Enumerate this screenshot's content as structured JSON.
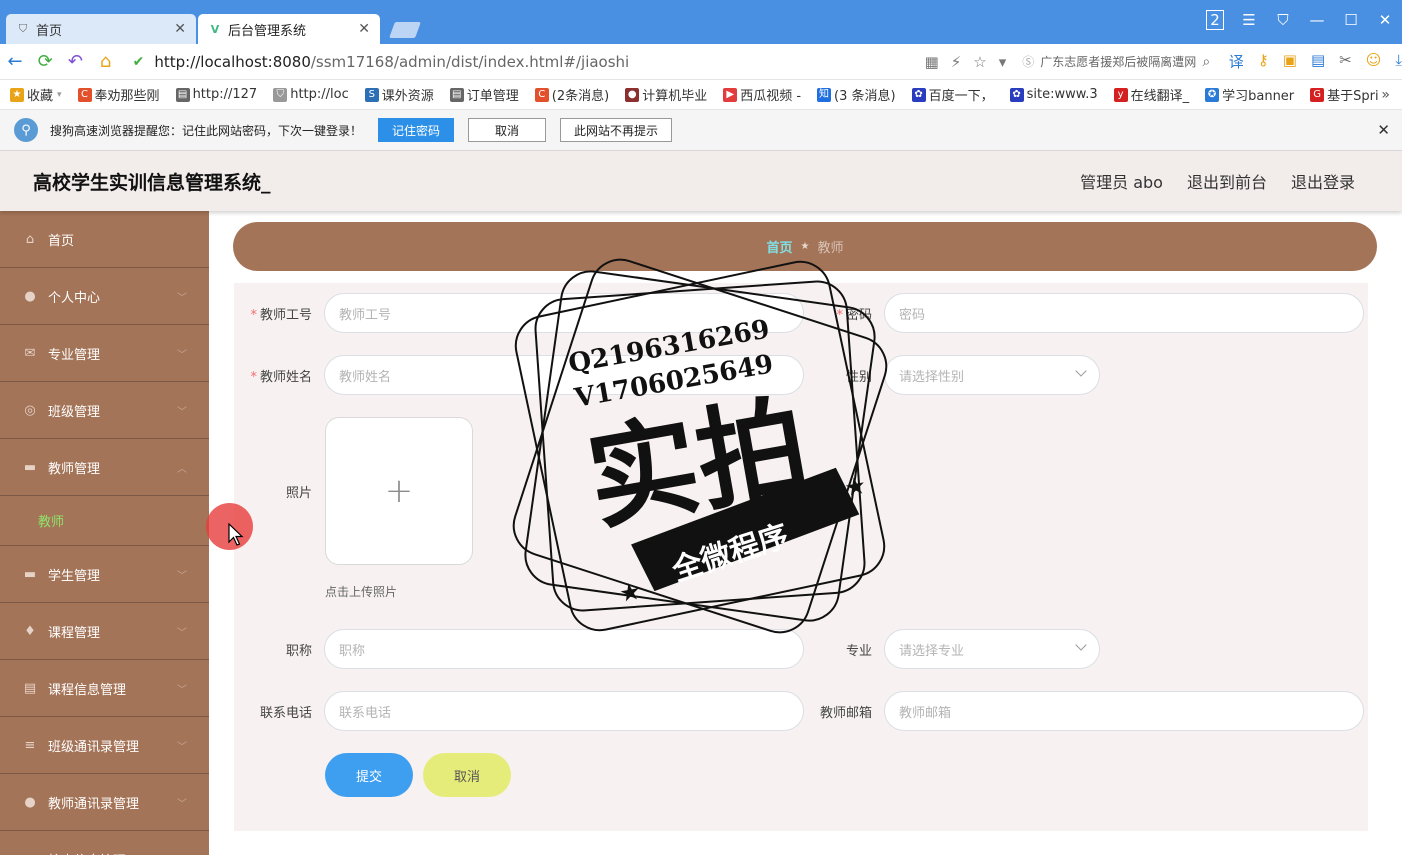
{
  "browser": {
    "tabs": [
      {
        "title": "首页",
        "active": false
      },
      {
        "title": "后台管理系统",
        "active": true
      }
    ],
    "url_host": "http://localhost:8080",
    "url_path": "/ssm17168/admin/dist/index.html#/jiaoshi",
    "search_text": "广东志愿者援郑后被隔离遭网",
    "window_badge": "2",
    "bookmarks": [
      {
        "label": "收藏",
        "icon": "star-icon",
        "color": "#e8a317"
      },
      {
        "label": "奉劝那些刚",
        "icon": "c-icon",
        "color": "#e2502c"
      },
      {
        "label": "http://127",
        "icon": "page-icon",
        "color": "#666666"
      },
      {
        "label": "http://loc",
        "icon": "shield-icon",
        "color": "#999999"
      },
      {
        "label": "课外资源",
        "icon": "sf-icon",
        "color": "#2d6fb5"
      },
      {
        "label": "订单管理",
        "icon": "page-icon",
        "color": "#666666"
      },
      {
        "label": "(2条消息)",
        "icon": "c-icon",
        "color": "#e2502c"
      },
      {
        "label": "计算机毕业",
        "icon": "user-icon",
        "color": "#8b2f2f"
      },
      {
        "label": "西瓜视频 -",
        "icon": "play-icon",
        "color": "#e23c3c"
      },
      {
        "label": "(3 条消息)",
        "icon": "zhi-icon",
        "color": "#1f6fe0"
      },
      {
        "label": "百度一下，",
        "icon": "paw-icon",
        "color": "#2b3dbf"
      },
      {
        "label": "site:www.3",
        "icon": "paw-icon",
        "color": "#2b3dbf"
      },
      {
        "label": "在线翻译_",
        "icon": "y-icon",
        "color": "#d42020"
      },
      {
        "label": "学习banner",
        "icon": "gear-icon",
        "color": "#2a7ad8"
      },
      {
        "label": "基于Spri",
        "icon": "g-icon",
        "color": "#d42020"
      }
    ],
    "notice": {
      "text": "搜狗高速浏览器提醒您：记住此网站密码，下次一键登录！",
      "remember_label": "记住密码",
      "cancel_label": "取消",
      "never_label": "此网站不再提示"
    }
  },
  "header": {
    "title": "高校学生实训信息管理系统_",
    "admin_label": "管理员 abo",
    "front_label": "退出到前台",
    "logout_label": "退出登录"
  },
  "sidebar": {
    "items": [
      {
        "label": "首页",
        "icon": "home-icon",
        "has_arrow": false
      },
      {
        "label": "个人中心",
        "icon": "user-icon",
        "has_arrow": true
      },
      {
        "label": "专业管理",
        "icon": "mail-icon",
        "has_arrow": true
      },
      {
        "label": "班级管理",
        "icon": "ring-icon",
        "has_arrow": true
      },
      {
        "label": "教师管理",
        "icon": "monitor-icon",
        "has_arrow": true,
        "expanded": true
      },
      {
        "label": "学生管理",
        "icon": "monitor-icon",
        "has_arrow": true
      },
      {
        "label": "课程管理",
        "icon": "mic-icon",
        "has_arrow": true
      },
      {
        "label": "课程信息管理",
        "icon": "doc-icon",
        "has_arrow": true
      },
      {
        "label": "班级通讯录管理",
        "icon": "list-icon",
        "has_arrow": true
      },
      {
        "label": "教师通讯录管理",
        "icon": "user-icon",
        "has_arrow": true
      },
      {
        "label": "校内信息管理",
        "icon": "list-icon",
        "has_arrow": true
      }
    ],
    "active_sub": "教师"
  },
  "breadcrumb": {
    "home": "首页",
    "current": "教师"
  },
  "form": {
    "teacher_no": {
      "label": "教师工号",
      "placeholder": "教师工号",
      "required": true
    },
    "password": {
      "label": "密码",
      "placeholder": "密码",
      "required": true
    },
    "teacher_name": {
      "label": "教师姓名",
      "placeholder": "教师姓名",
      "required": true
    },
    "gender": {
      "label": "性别",
      "placeholder": "请选择性别"
    },
    "photo": {
      "label": "照片",
      "tip": "点击上传照片"
    },
    "title": {
      "label": "职称",
      "placeholder": "职称"
    },
    "major": {
      "label": "专业",
      "placeholder": "请选择专业"
    },
    "phone": {
      "label": "联系电话",
      "placeholder": "联系电话"
    },
    "email": {
      "label": "教师邮箱",
      "placeholder": "教师邮箱"
    },
    "submit_label": "提交",
    "cancel_label": "取消"
  },
  "watermark": {
    "line1": "Q2196316269",
    "line2": "V1706025649",
    "big": "实拍",
    "ribbon": "全微程序"
  },
  "colors": {
    "sidebar_bg": "#a47458",
    "active_sub": "#8fe36a",
    "submit_btn": "#3e9ef0",
    "cancel_btn": "#e6ec79",
    "browser_accent": "#4a90e2"
  }
}
